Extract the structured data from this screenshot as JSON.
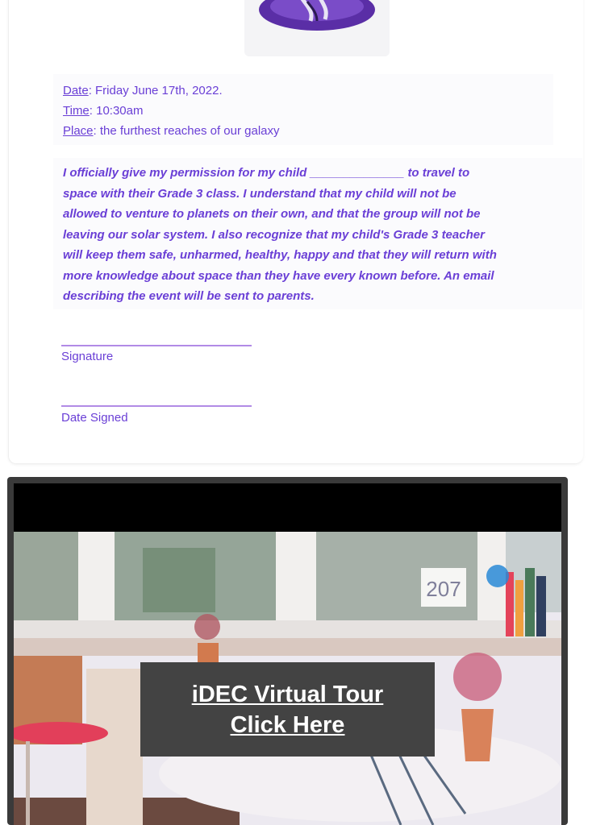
{
  "slip": {
    "date_label": "Date",
    "date_value": ": Friday June 17th, 2022.",
    "time_label": "Time",
    "time_value": ":  10:30am",
    "place_label": "Place",
    "place_value": ": the furthest reaches of our galaxy",
    "permission_lines": [
      "I officially give my permission for my child ______________ to travel to",
      "space with their Grade 3 class. I understand that my child will not be",
      "allowed to venture to planets on their own, and that the group will not be",
      "leaving our solar system. I also recognize that my child's Grade 3 teacher",
      "will keep them safe, unharmed, healthy, happy and that they will return with",
      "more knowledge about space than they have every known before. An email",
      "describing the event will be sent to parents."
    ],
    "signature_label": "Signature",
    "date_signed_label": "Date Signed"
  },
  "tour": {
    "room_number": "207",
    "button_line1": "iDEC Virtual Tour",
    "button_line2": "Click Here"
  },
  "colors": {
    "slip_text": "#6a3fd6",
    "logo_purple": "#5a2ea6",
    "tour_button_bg": "#434343"
  }
}
